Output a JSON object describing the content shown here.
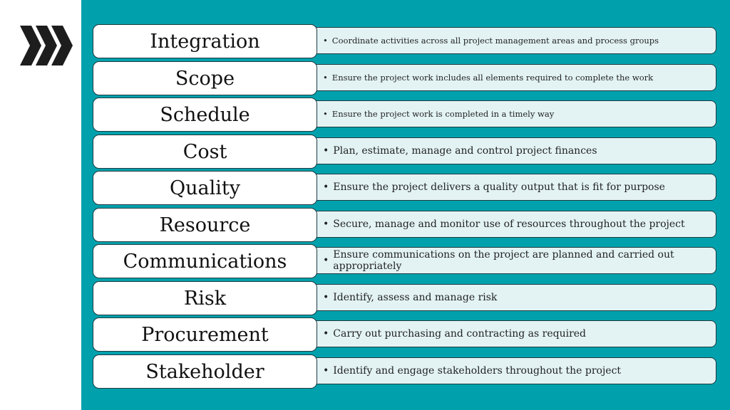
{
  "slide": {
    "icon": "triple-chevron-right-icon",
    "colors": {
      "panel": "#00a1ac",
      "label_bg": "#ffffff",
      "desc_bg": "#e3f3f4",
      "border": "#1f3a40"
    },
    "areas": [
      {
        "label": "Integration",
        "description": "Coordinate activities across all project management areas and process groups"
      },
      {
        "label": "Scope",
        "description": "Ensure the project work includes all elements required to complete the work"
      },
      {
        "label": "Schedule",
        "description": "Ensure the project work is completed in a timely way"
      },
      {
        "label": "Cost",
        "description": "Plan, estimate, manage and control project finances"
      },
      {
        "label": "Quality",
        "description": "Ensure the project delivers a quality output that is fit for purpose"
      },
      {
        "label": "Resource",
        "description": "Secure, manage and monitor use of resources throughout the project"
      },
      {
        "label": "Communications",
        "description": "Ensure communications on the project are planned and carried out appropriately"
      },
      {
        "label": "Risk",
        "description": "Identify, assess and manage risk"
      },
      {
        "label": "Procurement",
        "description": "Carry out purchasing and contracting as required"
      },
      {
        "label": "Stakeholder",
        "description": "Identify and engage stakeholders throughout the project"
      }
    ],
    "bullet": "•"
  }
}
